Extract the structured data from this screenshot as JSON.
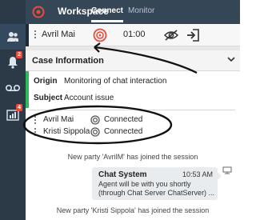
{
  "topbar": {
    "title": "Workspace",
    "tabs": [
      {
        "label": "Connect",
        "active": true
      },
      {
        "label": "Monitor",
        "active": false
      }
    ]
  },
  "rail": {
    "items": [
      {
        "icon": "contacts-icon",
        "active": true,
        "badge": null
      },
      {
        "icon": "bell-icon",
        "active": false,
        "badge": "2"
      },
      {
        "icon": "voicemail-icon",
        "active": false,
        "badge": null
      },
      {
        "icon": "dashboard-icon",
        "active": false,
        "badge": "4"
      }
    ]
  },
  "interaction_bar": {
    "party_name": "Avril Mai",
    "timer": "01:00"
  },
  "case_info": {
    "title": "Case Information",
    "fields": [
      {
        "label": "Origin",
        "value": "Monitoring of chat interaction"
      },
      {
        "label": "Subject",
        "value": "Account issue"
      }
    ]
  },
  "parties": [
    {
      "name": "Avril Mai",
      "status": "Connected"
    },
    {
      "name": "Kristi Sippola",
      "status": "Connected"
    }
  ],
  "transcript": {
    "join_1": "New party 'AvrilM' has joined the session",
    "message": {
      "sender": "Chat System",
      "time": "10:53 AM",
      "text": "Agent will be with you shortly (through Chat Server ChatServer) ..."
    },
    "join_2": "New party 'Kristi Sippola' has joined the session"
  },
  "colors": {
    "rail": "#2c3a47",
    "topbar": "#354657",
    "accent_green": "#2eb85c",
    "chat_red": "#e74c3c",
    "bubble": "#e9ecef"
  }
}
